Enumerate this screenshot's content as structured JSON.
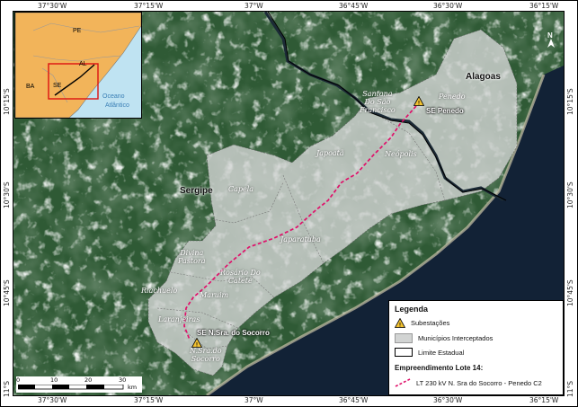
{
  "coords": {
    "top": [
      "37°30'W",
      "37°15'W",
      "37°W",
      "36°45'W",
      "36°30'W",
      "36°15'W"
    ],
    "bottom": [
      "37°30'W",
      "37°15'W",
      "37°W",
      "36°45'W",
      "36°30'W",
      "36°15'W"
    ],
    "left": [
      "10°15'S",
      "10°30'S",
      "10°45'S",
      "11°S"
    ],
    "right": [
      "10°15'S",
      "10°30'S",
      "10°45'S",
      "11°S"
    ]
  },
  "states": {
    "alagoas": "Alagoas",
    "sergipe": "Sergipe"
  },
  "municipalities": {
    "santana": [
      "Santana",
      "Do São",
      "Francisco"
    ],
    "penedo": "Penedo",
    "neopolis": "Neópolis",
    "japoata": "Japoatã",
    "capela": "Capela",
    "japaratuba": "Japaratuba",
    "divina": [
      "Divina",
      "Pastora"
    ],
    "rosario": [
      "Rosário Do",
      "Catete"
    ],
    "riachuelo": "Riachuelo",
    "maruim": "Maruim",
    "laranjeiras": "Laranjeiras",
    "nsra": [
      "N.Sra.do",
      "Socorro"
    ]
  },
  "substations": {
    "penedo": "SE Penedo",
    "socorro": "SE N.Sra. do Socorro"
  },
  "inset": {
    "pe": "PE",
    "al": "AL",
    "ba": "BA",
    "se": "SE",
    "ocean": [
      "Oceano",
      "Atlântico"
    ]
  },
  "legend": {
    "title": "Legenda",
    "items": [
      "Subestações",
      "Municípios Interceptados",
      "Limite Estadual"
    ],
    "subtitle": "Empreendimento Lote 14:",
    "line": "LT 230 kV N. Sra do Socorro - Penedo C2"
  },
  "scale": {
    "ticks": [
      "0",
      "10",
      "20",
      "30"
    ],
    "unit": "km"
  },
  "north": "N",
  "colors": {
    "sea": "#122236",
    "land": "#2f5a35",
    "muni": "#d2d4d3",
    "line": "#e0106a",
    "insetLand": "#f2b45a",
    "insetSea": "#bfe3f2"
  }
}
